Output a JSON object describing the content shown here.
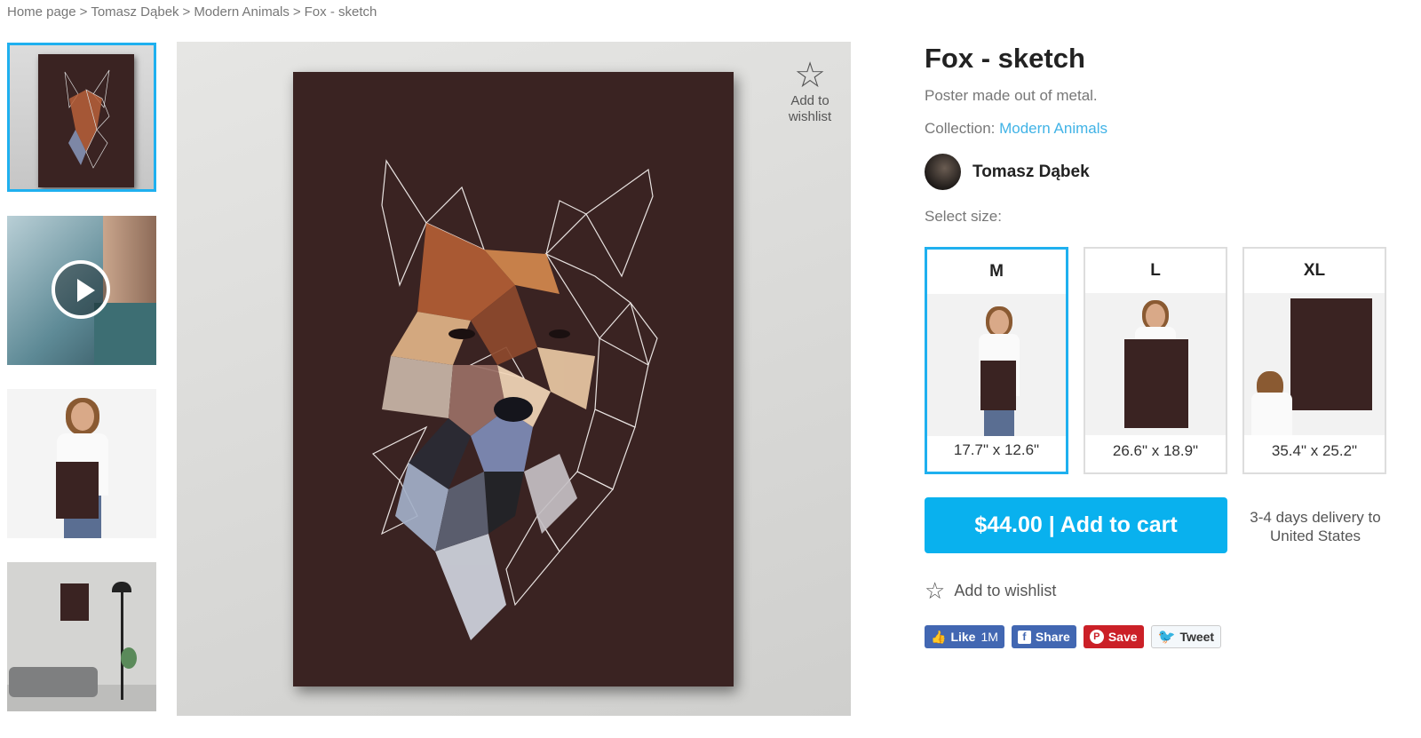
{
  "breadcrumb": [
    "Home page",
    "Tomasz Dąbek",
    "Modern Animals",
    "Fox - sketch"
  ],
  "product": {
    "title": "Fox - sketch",
    "description": "Poster made out of metal.",
    "collection_label": "Collection:",
    "collection_name": "Modern Animals",
    "author": "Tomasz Dąbek",
    "select_size_label": "Select size:",
    "sizes": [
      {
        "name": "M",
        "dims": "17.7\" x 12.6\""
      },
      {
        "name": "L",
        "dims": "26.6\" x 18.9\""
      },
      {
        "name": "XL",
        "dims": "35.4\" x 25.2\""
      }
    ],
    "selected_size": "M",
    "cart_label": "$44.00 | Add to cart",
    "delivery": "3-4 days delivery to United States",
    "wishlist_label": "Add to wishlist",
    "wishlist_top_label": "Add to wishlist"
  },
  "social": {
    "like": "Like",
    "like_count": "1M",
    "share": "Share",
    "save": "Save",
    "tweet": "Tweet"
  },
  "colors": {
    "accent": "#1fb0ef",
    "cart": "#09b1ee",
    "poster_bg": "#3a2322",
    "facebook": "#4267b2",
    "pinterest": "#cb2027",
    "link": "#41b3e6"
  }
}
